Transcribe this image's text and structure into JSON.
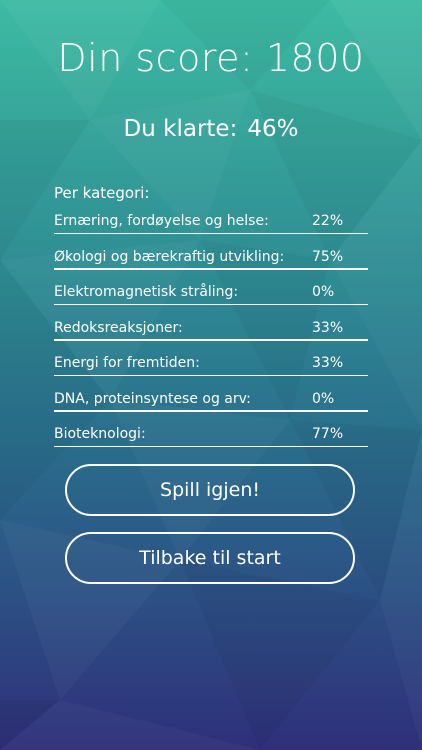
{
  "score": {
    "title": "Din score: 1800"
  },
  "result": {
    "label": "Du klarte:",
    "percent": "46%"
  },
  "categories": {
    "heading": "Per kategori:",
    "items": [
      {
        "name": "Ernæring, fordøyelse og helse:",
        "value": "22%"
      },
      {
        "name": "Økologi og bærekraftig utvikling:",
        "value": "75%"
      },
      {
        "name": "Elektromagnetisk stråling:",
        "value": "0%"
      },
      {
        "name": "Redoksreaksjoner:",
        "value": "33%"
      },
      {
        "name": "Energi for fremtiden:",
        "value": "33%"
      },
      {
        "name": "DNA, proteinsyntese og arv:",
        "value": "0%"
      },
      {
        "name": "Bioteknologi:",
        "value": "77%"
      }
    ]
  },
  "buttons": {
    "replay": "Spill igjen!",
    "home": "Tilbake til start"
  },
  "colors": {
    "gradient_top": "#3dbba3",
    "gradient_bottom": "#2f2f7a",
    "text": "#ffffff"
  }
}
